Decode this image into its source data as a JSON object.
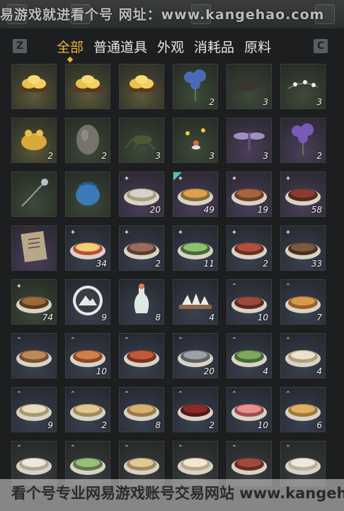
{
  "watermark_top": "易游戏就进看个号 网址：www.kangehao.com",
  "watermark_bottom": "看个号专业网易游戏账号交易网站 www.kangehao.com",
  "key_left": "Z",
  "key_right": "C",
  "tabs": [
    {
      "label": "全部",
      "active": true
    },
    {
      "label": "普通道具",
      "active": false
    },
    {
      "label": "外观",
      "active": false
    },
    {
      "label": "消耗品",
      "active": false
    },
    {
      "label": "原料",
      "active": false
    }
  ],
  "items": [
    {
      "name": "gold-ingots",
      "rarity": "gold",
      "count": "",
      "badge": ""
    },
    {
      "name": "gold-ingots",
      "rarity": "gold",
      "count": "",
      "badge": ""
    },
    {
      "name": "gold-ingots",
      "rarity": "gold",
      "count": "",
      "badge": ""
    },
    {
      "name": "blue-flower",
      "rarity": "green",
      "count": "2",
      "badge": ""
    },
    {
      "name": "rat",
      "rarity": "green",
      "count": "3",
      "badge": ""
    },
    {
      "name": "white-blossom",
      "rarity": "green",
      "count": "3",
      "badge": ""
    },
    {
      "name": "golden-toad",
      "rarity": "gold",
      "count": "2",
      "badge": ""
    },
    {
      "name": "stone-egg",
      "rarity": "green",
      "count": "2",
      "badge": ""
    },
    {
      "name": "cricket",
      "rarity": "green",
      "count": "3",
      "badge": ""
    },
    {
      "name": "fireflies",
      "rarity": "green",
      "count": "3",
      "badge": ""
    },
    {
      "name": "dragonfly",
      "rarity": "purple",
      "count": "3",
      "badge": ""
    },
    {
      "name": "purple-flower",
      "rarity": "purple",
      "count": "2",
      "badge": ""
    },
    {
      "name": "silver-hairpin",
      "rarity": "green",
      "count": "",
      "badge": ""
    },
    {
      "name": "blue-pouch",
      "rarity": "green",
      "count": "",
      "badge": ""
    },
    {
      "name": "noodle-soup",
      "rarity": "purple",
      "count": "20",
      "badge": "+"
    },
    {
      "name": "egg-soup",
      "rarity": "purple",
      "count": "49",
      "badge": "+",
      "flag": true
    },
    {
      "name": "grilled-fish",
      "rarity": "purple",
      "count": "19",
      "badge": "+"
    },
    {
      "name": "beef-bowl",
      "rarity": "purple",
      "count": "58",
      "badge": "+"
    },
    {
      "name": "letter",
      "rarity": "purple",
      "count": "",
      "badge": ""
    },
    {
      "name": "fried-egg-plate",
      "rarity": "blue",
      "count": "34",
      "badge": "+"
    },
    {
      "name": "sliced-meat",
      "rarity": "blue",
      "count": "2",
      "badge": "+"
    },
    {
      "name": "cucumber-plate",
      "rarity": "blue",
      "count": "11",
      "badge": "+"
    },
    {
      "name": "sausages",
      "rarity": "blue",
      "count": "2",
      "badge": "+"
    },
    {
      "name": "stir-fry",
      "rarity": "blue",
      "count": "33",
      "badge": "+"
    },
    {
      "name": "clay-pot-stew",
      "rarity": "green",
      "count": "74",
      "badge": "+"
    },
    {
      "name": "mountain-token",
      "rarity": "blue",
      "count": "9",
      "badge": ""
    },
    {
      "name": "vase",
      "rarity": "blue",
      "count": "8",
      "badge": ""
    },
    {
      "name": "rice-cakes",
      "rarity": "blue",
      "count": "4",
      "badge": ""
    },
    {
      "name": "braised-meat",
      "rarity": "blue",
      "count": "10",
      "badge": "^"
    },
    {
      "name": "cake-slice",
      "rarity": "blue",
      "count": "7",
      "badge": "^"
    },
    {
      "name": "fish-plate",
      "rarity": "blue",
      "count": "",
      "badge": "^"
    },
    {
      "name": "shrimp-soup",
      "rarity": "blue",
      "count": "10",
      "badge": "^"
    },
    {
      "name": "hotpot",
      "rarity": "blue",
      "count": "",
      "badge": "^"
    },
    {
      "name": "fish-dish",
      "rarity": "blue",
      "count": "20",
      "badge": "^"
    },
    {
      "name": "green-salad",
      "rarity": "blue",
      "count": "4",
      "badge": "^"
    },
    {
      "name": "steamed-bun",
      "rarity": "blue",
      "count": "4",
      "badge": "^"
    },
    {
      "name": "porridge",
      "rarity": "blue",
      "count": "9",
      "badge": "^"
    },
    {
      "name": "noodles",
      "rarity": "blue",
      "count": "2",
      "badge": "^"
    },
    {
      "name": "broth-noodles",
      "rarity": "blue",
      "count": "8",
      "badge": "^"
    },
    {
      "name": "red-soup",
      "rarity": "blue",
      "count": "2",
      "badge": "^"
    },
    {
      "name": "sashimi",
      "rarity": "blue",
      "count": "10",
      "badge": "^"
    },
    {
      "name": "rice-bowl",
      "rarity": "blue",
      "count": "6",
      "badge": "^"
    },
    {
      "name": "dumplings",
      "rarity": "grey",
      "count": "",
      "badge": "^"
    },
    {
      "name": "veg-bowl",
      "rarity": "grey",
      "count": "",
      "badge": "^"
    },
    {
      "name": "soup-bowl",
      "rarity": "grey",
      "count": "",
      "badge": "^"
    },
    {
      "name": "cream-soup",
      "rarity": "grey",
      "count": "",
      "badge": "^"
    },
    {
      "name": "meat-platter",
      "rarity": "grey",
      "count": "",
      "badge": "^"
    },
    {
      "name": "rice-pot",
      "rarity": "grey",
      "count": "",
      "badge": "^"
    }
  ],
  "colors": {
    "active_tab": "#f0b23c",
    "count_text": "#f2f2f2"
  }
}
